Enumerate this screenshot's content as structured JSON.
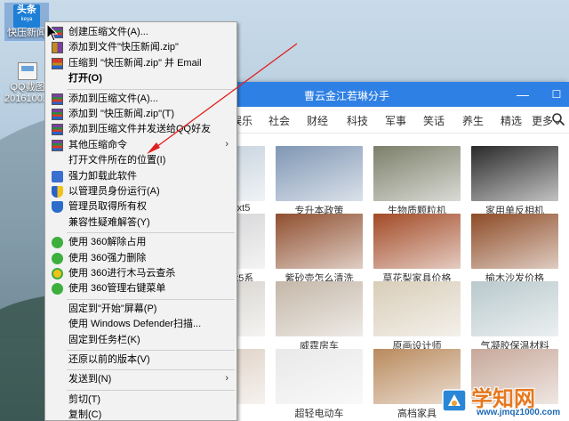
{
  "desktop": {
    "icons": [
      {
        "label": "快压新闻",
        "logo_text": "头条",
        "logo_sub": "keya"
      },
      {
        "label_line1": "QQ截图",
        "label_line2": "2016100..."
      }
    ]
  },
  "window": {
    "title": "曹云金江若琳分手",
    "tabs": [
      "娱乐",
      "社会",
      "财经",
      "科技",
      "军事",
      "笑话",
      "养生",
      "精选",
      "更多"
    ],
    "grid": [
      {
        "caption": "xt5",
        "color": "#c8d4df"
      },
      {
        "caption": "专升本政策",
        "color": "#7f96b4"
      },
      {
        "caption": "生物质颗粒机",
        "color": "#7c7f6a"
      },
      {
        "caption": "家用单反相机",
        "color": "#2a2a2a"
      },
      {
        "caption": "x5系",
        "color": "#d7d7d9"
      },
      {
        "caption": "紫砂壶怎么清洗",
        "color": "#8f4f2f"
      },
      {
        "caption": "草花梨家具价格",
        "color": "#a24a26"
      },
      {
        "caption": "榆木沙发价格",
        "color": "#8d4b26"
      },
      {
        "caption": "",
        "color": "#d9d6d1"
      },
      {
        "caption": "威霆房车",
        "color": "#c4b7a8"
      },
      {
        "caption": "原画设计师",
        "color": "#d8cdb8"
      },
      {
        "caption": "气凝胶保温材料",
        "color": "#b9c9cc"
      },
      {
        "caption": "",
        "color": "#e0d3c8"
      },
      {
        "caption": "超轻电动车",
        "color": "#e9e9ea"
      },
      {
        "caption": "高档家具",
        "color": "#b98a5d"
      },
      {
        "caption": "",
        "color": "#c7a89a"
      }
    ]
  },
  "menu": {
    "items": [
      {
        "label": "创建压缩文件(A)...",
        "icon": "winrar-icon"
      },
      {
        "label": "添加到文件\"快压新闻.zip\"",
        "icon": "zip-icon"
      },
      {
        "label": "压缩到 \"快压新闻.zip\" 并 Email",
        "icon": "zip-email-icon"
      },
      {
        "label": "打开(O)",
        "icon": "",
        "bold": true
      },
      {
        "label": "添加到压缩文件(A)...",
        "icon": "winrar-icon"
      },
      {
        "label": "添加到 \"快压新闻.zip\"(T)",
        "icon": "winrar-icon"
      },
      {
        "label": "添加到压缩文件并发送给QQ好友",
        "icon": "winrar-icon"
      },
      {
        "label": "其他压缩命令",
        "icon": "winrar-icon",
        "submenu": true
      },
      {
        "label": "打开文件所在的位置(I)",
        "icon": ""
      },
      {
        "label": "强力卸载此软件",
        "icon": "hammer-icon"
      },
      {
        "label": "以管理员身份运行(A)",
        "icon": "uac-shield-icon"
      },
      {
        "label": "管理员取得所有权",
        "icon": "admin-shield-icon"
      },
      {
        "label": "兼容性疑难解答(Y)",
        "icon": ""
      },
      {
        "label": "使用 360解除占用",
        "icon": "360-icon"
      },
      {
        "label": "使用 360强力删除",
        "icon": "360-icon"
      },
      {
        "label": "使用 360进行木马云查杀",
        "icon": "360-scan-icon"
      },
      {
        "label": "使用 360管理右键菜单",
        "icon": "360-icon"
      },
      {
        "label": "固定到\"开始\"屏幕(P)",
        "icon": ""
      },
      {
        "label": "使用 Windows Defender扫描...",
        "icon": ""
      },
      {
        "label": "固定到任务栏(K)",
        "icon": ""
      },
      {
        "label": "还原以前的版本(V)",
        "icon": ""
      },
      {
        "label": "发送到(N)",
        "icon": "",
        "submenu": true
      },
      {
        "label": "剪切(T)",
        "icon": ""
      },
      {
        "label": "复制(C)",
        "icon": ""
      }
    ]
  },
  "watermark": {
    "text": "学知网",
    "url": "www.jmqz1000.com"
  },
  "colors": {
    "titlebar": "#2f80e4",
    "menu_bg": "#f2f2f2",
    "annotation_arrow": "#e02020"
  }
}
